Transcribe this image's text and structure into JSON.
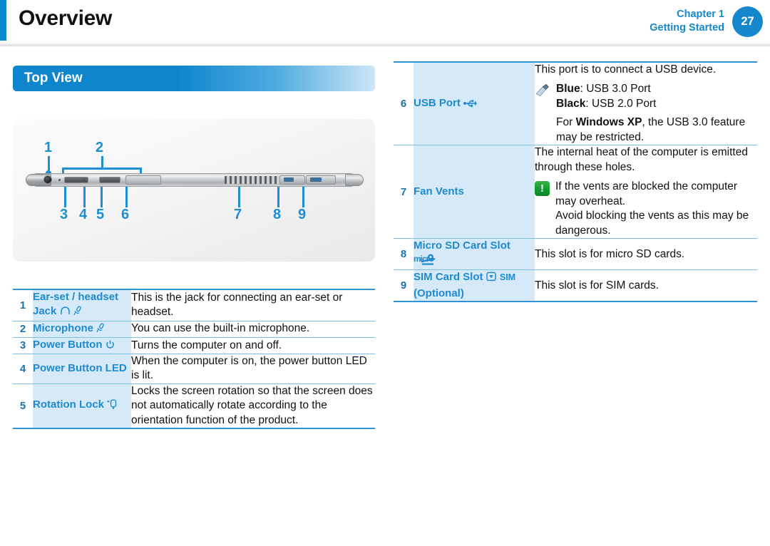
{
  "header": {
    "title": "Overview",
    "chapter_line1": "Chapter 1",
    "chapter_line2": "Getting Started",
    "page_number": "27",
    "accent_color": "#0d87cd",
    "title_color": "#111111"
  },
  "section": {
    "banner_label": "Top View",
    "banner_color": "#0e85cc"
  },
  "illustration": {
    "callouts": [
      "1",
      "2",
      "3",
      "4",
      "5",
      "6",
      "7",
      "8",
      "9"
    ],
    "line_color": "#1c8fd4",
    "alt": "Side edge view of the tablet computer showing ports and buttons"
  },
  "left_table": {
    "rows": [
      {
        "num": "1",
        "label": "Ear-set / headset Jack",
        "icons": [
          "headphone-icon",
          "microphone-icon"
        ],
        "desc": "This is the jack for connecting an ear-set or headset."
      },
      {
        "num": "2",
        "label": "Microphone",
        "icons": [
          "microphone-icon"
        ],
        "desc": "You can use the built-in microphone."
      },
      {
        "num": "3",
        "label": "Power Button",
        "icons": [
          "power-icon"
        ],
        "desc": "Turns the computer on and off."
      },
      {
        "num": "4",
        "label": "Power Button LED",
        "icons": [],
        "desc": "When the computer is on, the power button LED is lit."
      },
      {
        "num": "5",
        "label": "Rotation Lock",
        "icons": [
          "rotation-lock-icon"
        ],
        "desc": "Locks the screen rotation so that the screen does not automatically rotate according to the orientation function of the product."
      }
    ]
  },
  "right_table": {
    "rows": [
      {
        "num": "6",
        "label": "USB Port",
        "icons": [
          "usb-icon"
        ],
        "desc_lead": "This port is to connect a USB device.",
        "note_icon": "note-pencil-icon",
        "note_bold_1": "Blue",
        "note_rest_1": ": USB 3.0 Port",
        "note_bold_2": "Black",
        "note_rest_2": ": USB 2.0 Port",
        "note_tail_pre": "For ",
        "note_tail_bold": "Windows XP",
        "note_tail_post": ", the USB 3.0 feature may be restricted."
      },
      {
        "num": "7",
        "label": "Fan Vents",
        "icons": [],
        "desc_lead": "The internal heat of the computer is emitted through these holes.",
        "caution_icon": "caution-exclamation-icon",
        "caution_text_1": "If the vents are blocked the computer may overheat.",
        "caution_text_2": "Avoid blocking the vents as this may be dangerous."
      },
      {
        "num": "8",
        "label": "Micro SD Card Slot",
        "icons": [
          "micro-sd-logo-icon"
        ],
        "desc_lead": "This slot is for micro SD cards."
      },
      {
        "num": "9",
        "label": "SIM Card Slot",
        "label_suffix": "(Optional)",
        "icons": [
          "sim-card-icon"
        ],
        "sim_text": "SIM",
        "desc_lead": "This slot is for SIM cards."
      }
    ]
  },
  "colors": {
    "label_cell_bg": "#d5e9f8",
    "label_text": "#1f8ad0",
    "rule": "#2f93d4",
    "caution_green": "#119b2e"
  }
}
